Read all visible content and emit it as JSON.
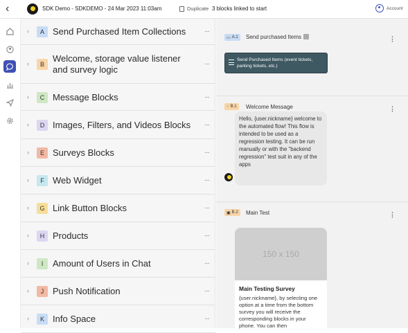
{
  "header": {
    "back_glyph": "‹",
    "title": "SDK Demo - SDKDEMO - 24 Mar 2023 11:03am",
    "duplicate_label": "Duplicate",
    "linked_text": "3 blocks linked to start",
    "account_label": "Account",
    "accent": "#3f51b5"
  },
  "rail": {
    "icons": [
      "home-icon",
      "user-icon",
      "chat-icon",
      "chart-icon",
      "send-icon",
      "settings-icon"
    ],
    "active": "chat-icon"
  },
  "blocks": [
    {
      "letter": "A",
      "label": "Send Purchased Item Collections",
      "color": "#c8dcf5"
    },
    {
      "letter": "B",
      "label": "Welcome, storage value listener and survey logic",
      "color": "#f9d5a8"
    },
    {
      "letter": "C",
      "label": "Message Blocks",
      "color": "#cfe7c4"
    },
    {
      "letter": "D",
      "label": "Images, Filters, and Videos Blocks",
      "color": "#ddd6f2"
    },
    {
      "letter": "E",
      "label": "Surveys Blocks",
      "color": "#f2b9a4"
    },
    {
      "letter": "F",
      "label": "Web Widget",
      "color": "#c6e7ee"
    },
    {
      "letter": "G",
      "label": "Link Button Blocks",
      "color": "#f7de98"
    },
    {
      "letter": "H",
      "label": "Products",
      "color": "#ddd6f2"
    },
    {
      "letter": "I",
      "label": "Amount of Users in Chat",
      "color": "#cfe7c4"
    },
    {
      "letter": "J",
      "label": "Push Notification",
      "color": "#f2b9a4"
    },
    {
      "letter": "K",
      "label": "Info Space",
      "color": "#c8dcf5"
    }
  ],
  "more_glyph": "···",
  "kebab_glyph": "⋮",
  "detail": {
    "a1": {
      "tag": "A.1",
      "title": "Send purchased Items",
      "button_label": "Send Purchased Items (event tickets, parking tickets, etc.)",
      "tag_color": "#c8dcf5"
    },
    "b1": {
      "tag": "B.1",
      "title": "Welcome Message",
      "message": "Hello, {user.nickname} welcome to the automated flow! This flow is intended to be used as a regression testing. It can be run manually or with the \"backend regression\" test suit in any of the apps",
      "tag_color": "#f9d5a8"
    },
    "b2": {
      "tag": "B.2",
      "title": "Main Test",
      "image_placeholder": "150 x 150",
      "card_title": "Main Testing Survey",
      "card_body": "{user.nickname}, by selecting one option at a time from the bottom survey you will receive the corresponding blocks in your phone. You can then",
      "tag_color": "#f9d5a8"
    }
  }
}
